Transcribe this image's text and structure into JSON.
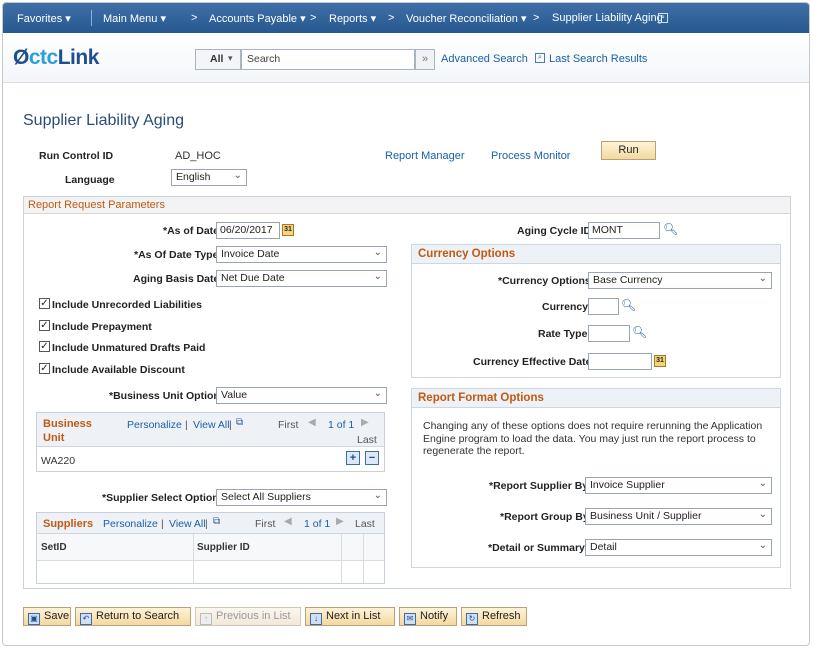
{
  "nav": {
    "favorites": "Favorites ▾",
    "main_menu": "Main Menu ▾",
    "crumbs": [
      "Accounts Payable ▾",
      "Reports ▾",
      "Voucher Reconciliation ▾",
      "Supplier Liability Aging"
    ],
    "crumb_sep": ">"
  },
  "header": {
    "logo_prefix": "ctc",
    "logo_suffix": "Link",
    "search_scope": "All",
    "search_placeholder": "Search",
    "advanced_search": "Advanced Search",
    "last_search_results": "Last Search Results"
  },
  "page": {
    "title": "Supplier Liability Aging",
    "run_control_label": "Run Control ID",
    "run_control_value": "AD_HOC",
    "report_manager": "Report Manager",
    "process_monitor": "Process Monitor",
    "run_button": "Run",
    "language_label": "Language",
    "language_value": "English"
  },
  "params": {
    "section_title": "Report Request Parameters",
    "as_of_date_label": "*As of Date",
    "as_of_date_value": "06/20/2017",
    "as_of_date_type_label": "*As Of Date Type",
    "as_of_date_type_value": "Invoice Date",
    "aging_basis_label": "Aging Basis Date",
    "aging_basis_value": "Net Due Date",
    "checkboxes": [
      {
        "label": "Include Unrecorded Liabilities",
        "checked": true
      },
      {
        "label": "Include Prepayment",
        "checked": true
      },
      {
        "label": "Include Unmatured Drafts Paid",
        "checked": true
      },
      {
        "label": "Include Available Discount",
        "checked": true
      }
    ],
    "bu_option_label": "*Business Unit Option",
    "bu_option_value": "Value",
    "bu_grid": {
      "title_line1": "Business",
      "title_line2": "Unit",
      "personalize": "Personalize",
      "view_all": "View All",
      "first": "First",
      "count": "1 of 1",
      "last": "Last",
      "row_value": "WA220"
    },
    "supplier_option_label": "*Supplier Select Option",
    "supplier_option_value": "Select All Suppliers",
    "suppliers_grid": {
      "title": "Suppliers",
      "personalize": "Personalize",
      "view_all": "View All",
      "first": "First",
      "count": "1 of 1",
      "last": "Last",
      "col1": "SetID",
      "col2": "Supplier ID"
    },
    "aging_cycle_label": "Aging Cycle ID",
    "aging_cycle_value": "MONT",
    "currency": {
      "title": "Currency Options",
      "options_label": "*Currency Options",
      "options_value": "Base Currency",
      "currency_label": "Currency",
      "rate_type_label": "Rate Type",
      "eff_date_label": "Currency Effective Date"
    },
    "format": {
      "title": "Report Format Options",
      "note": "Changing any of these options does not require rerunning the Application Engine program to load the data. You may just run the report process to regenerate the report.",
      "supplier_by_label": "*Report Supplier By",
      "supplier_by_value": "Invoice Supplier",
      "group_by_label": "*Report Group By",
      "group_by_value": "Business Unit / Supplier",
      "detail_label": "*Detail or Summary",
      "detail_value": "Detail"
    }
  },
  "toolbar": {
    "save": "Save",
    "return_to_search": "Return to Search",
    "previous_in_list": "Previous in List",
    "next_in_list": "Next in List",
    "notify": "Notify",
    "refresh": "Refresh"
  },
  "colors": {
    "nav_bar": "#2f5f99",
    "section_header": "#c05a14",
    "link": "#1a5fa8",
    "button": "#f3d9a0"
  }
}
